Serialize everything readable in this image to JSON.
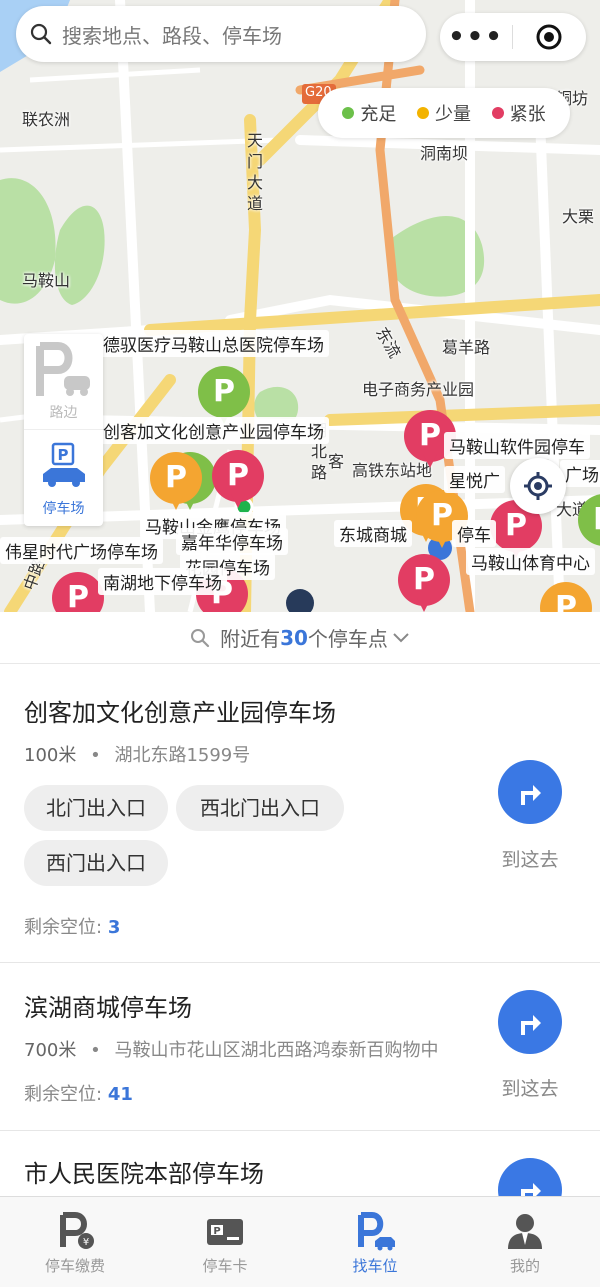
{
  "search": {
    "placeholder": "搜索地点、路段、停车场"
  },
  "capsule": {
    "more": "•••"
  },
  "legend": [
    {
      "label": "充足",
      "color": "#6cc04a"
    },
    {
      "label": "少量",
      "color": "#f3b300"
    },
    {
      "label": "紧张",
      "color": "#e23d63"
    }
  ],
  "map": {
    "places": [
      "联农洲",
      "马鞍山",
      "洞南坝",
      "葛羊路",
      "大栗",
      "铜坊",
      "电子商务产业园",
      "高铁东站地",
      "客"
    ],
    "roads": {
      "tianmen": "天门大道",
      "hubei": "湖北路",
      "dongliu": "东流",
      "highway": "G20",
      "dadao": "大道",
      "zhonglu": "中路"
    },
    "parking_labels": [
      "德驭医疗马鞍山总医院停车场",
      "创客加文化创意产业园停车场",
      "马鞍山软件园停车",
      "星悦广",
      "广场",
      "嘉年华停车场",
      "东城商城",
      "停车",
      "马鞍山体育中心",
      "伟星时代广场停车场",
      "南湖地下停车场",
      "马鞍山金鹰停车场",
      "花园停车场"
    ],
    "pin_letter": "P"
  },
  "side_toggle": {
    "roadside": "路边",
    "lot": "停车场"
  },
  "nearby": {
    "prefix": "附近有",
    "count": "30",
    "suffix": "个停车点"
  },
  "parking_list": [
    {
      "name": "创客加文化创意产业园停车场",
      "distance": "100米",
      "address": "湖北东路1599号",
      "entrances": [
        "北门出入口",
        "西北门出入口",
        "西门出入口"
      ],
      "remaining_label": "剩余空位:",
      "remaining": "3",
      "go": "到这去"
    },
    {
      "name": "滨湖商城停车场",
      "distance": "700米",
      "address": "马鞍山市花山区湖北西路鸿泰新百购物中",
      "entrances": [],
      "remaining_label": "剩余空位:",
      "remaining": "41",
      "go": "到这去"
    },
    {
      "name": "市人民医院本部停车场"
    }
  ],
  "tabs": [
    {
      "label": "停车缴费",
      "icon": "parking-pay-icon",
      "active": false
    },
    {
      "label": "停车卡",
      "icon": "parking-card-icon",
      "active": false
    },
    {
      "label": "找车位",
      "icon": "find-parking-icon",
      "active": true
    },
    {
      "label": "我的",
      "icon": "user-icon",
      "active": false
    }
  ]
}
